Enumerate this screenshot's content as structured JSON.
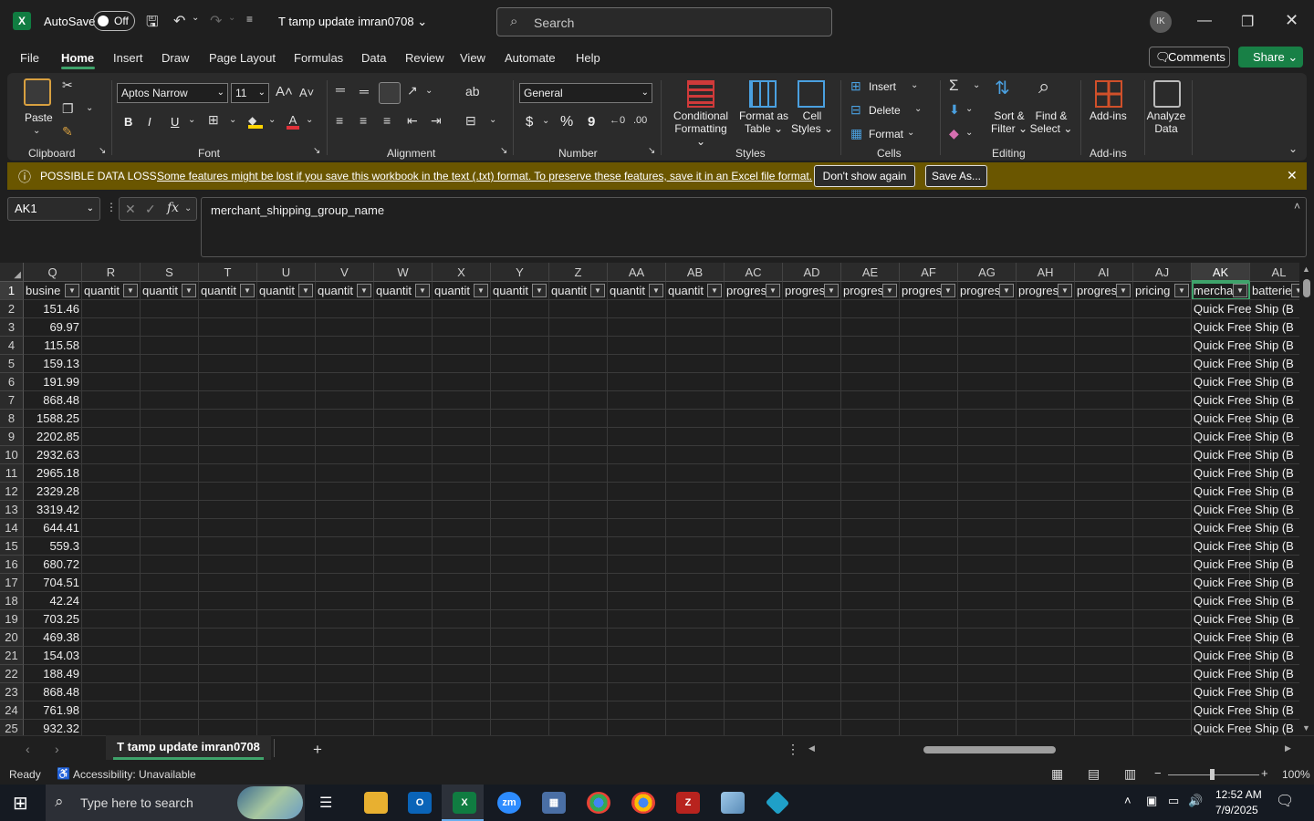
{
  "titlebar": {
    "autosave_label": "AutoSave",
    "autosave_state": "Off",
    "doc_title": "T tamp update imran0708",
    "search_placeholder": "Search",
    "avatar_initials": "IK"
  },
  "menu": {
    "items": [
      "File",
      "Home",
      "Insert",
      "Draw",
      "Page Layout",
      "Formulas",
      "Data",
      "Review",
      "View",
      "Automate",
      "Help"
    ],
    "active": "Home",
    "comments_label": "Comments",
    "share_label": "Share"
  },
  "ribbon": {
    "clipboard": {
      "paste": "Paste",
      "label": "Clipboard"
    },
    "font": {
      "family": "Aptos Narrow",
      "size": "11",
      "bold": "B",
      "italic": "I",
      "underline": "U",
      "label": "Font"
    },
    "alignment": {
      "label": "Alignment"
    },
    "number": {
      "format": "General",
      "currency": "$",
      "percent": "%",
      "comma": "9",
      "label": "Number"
    },
    "styles": {
      "conditional": [
        "Conditional",
        "Formatting"
      ],
      "format_table": [
        "Format as",
        "Table"
      ],
      "cell_styles": [
        "Cell",
        "Styles"
      ],
      "label": "Styles"
    },
    "cells": {
      "insert": "Insert",
      "delete": "Delete",
      "format": "Format",
      "label": "Cells"
    },
    "editing": {
      "sort": [
        "Sort &",
        "Filter"
      ],
      "find": [
        "Find &",
        "Select"
      ],
      "label": "Editing"
    },
    "addins": {
      "addins": "Add-ins",
      "label": "Add-ins"
    },
    "analyze": {
      "line1": "Analyze",
      "line2": "Data"
    }
  },
  "infobar": {
    "title": "POSSIBLE DATA LOSS",
    "message": "Some features might be lost if you save this workbook in the text (.txt) format. To preserve these features, save it in an Excel file format.",
    "dont_show": "Don't show again",
    "save_as": "Save As..."
  },
  "formula_bar": {
    "name_box": "AK1",
    "fx": "fx",
    "content": "merchant_shipping_group_name"
  },
  "grid": {
    "columns": [
      "Q",
      "R",
      "S",
      "T",
      "U",
      "V",
      "W",
      "X",
      "Y",
      "Z",
      "AA",
      "AB",
      "AC",
      "AD",
      "AE",
      "AF",
      "AG",
      "AH",
      "AI",
      "AJ",
      "AK",
      "AL"
    ],
    "selected_column": "AK",
    "headers": [
      "busine",
      "quantit",
      "quantit",
      "quantit",
      "quantit",
      "quantit",
      "quantit",
      "quantit",
      "quantit",
      "quantit",
      "quantit",
      "quantit",
      "progres",
      "progres",
      "progres",
      "progres",
      "progres",
      "progres",
      "progres",
      "pricing",
      "mercha",
      "batterie"
    ],
    "rows": [
      "1",
      "2",
      "3",
      "4",
      "5",
      "6",
      "7",
      "8",
      "9",
      "10",
      "11",
      "12",
      "13",
      "14",
      "15",
      "16",
      "17",
      "18",
      "19",
      "20",
      "21",
      "22",
      "23",
      "24",
      "25"
    ],
    "q_values": [
      "151.46",
      "69.97",
      "115.58",
      "159.13",
      "191.99",
      "868.48",
      "1588.25",
      "2202.85",
      "2932.63",
      "2965.18",
      "2329.28",
      "3319.42",
      "644.41",
      "559.3",
      "680.72",
      "704.51",
      "42.24",
      "703.25",
      "469.38",
      "154.03",
      "188.49",
      "868.48",
      "761.98",
      "932.32"
    ],
    "ak_value": "Quick Free Ship (B"
  },
  "sheets": {
    "active": "T tamp update imran0708",
    "add": "+"
  },
  "status": {
    "ready": "Ready",
    "accessibility": "Accessibility: Unavailable",
    "zoom": "100%"
  },
  "taskbar": {
    "search_placeholder": "Type here to search",
    "time": "12:52 AM",
    "date": "7/9/2025"
  }
}
